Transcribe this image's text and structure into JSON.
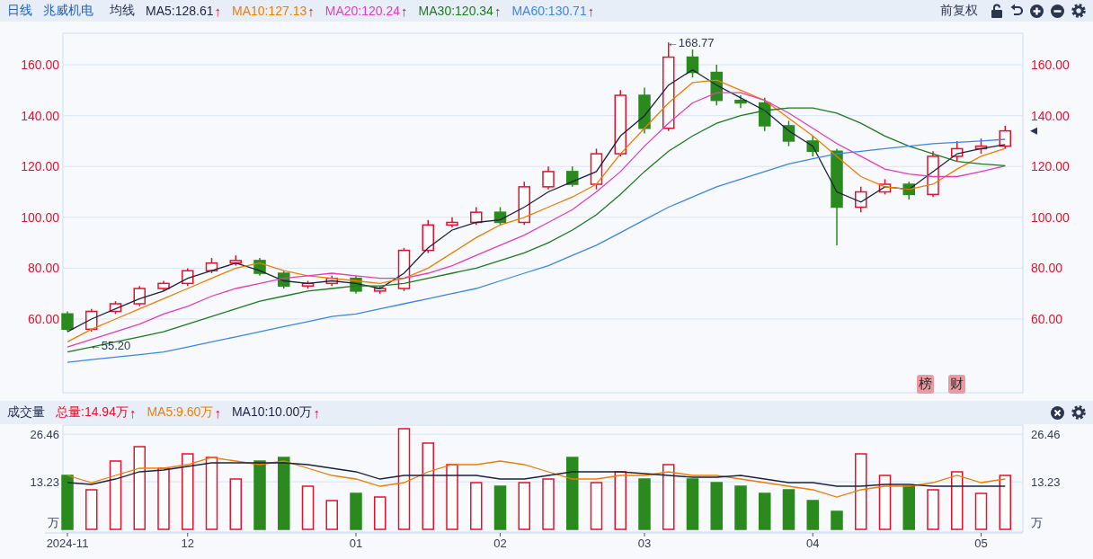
{
  "toolbar": {
    "period": "日线",
    "stock": "兆威机电",
    "indicator_title": "均线",
    "indicators": [
      {
        "label": "MA5:128.61",
        "color": "#1a2340",
        "arrow": "↑"
      },
      {
        "label": "MA10:127.13",
        "color": "#f07d00",
        "arrow": "↑"
      },
      {
        "label": "MA20:120.24",
        "color": "#e83cb4",
        "arrow": "↑"
      },
      {
        "label": "MA30:120.34",
        "color": "#1e7a1e",
        "arrow": "↑"
      },
      {
        "label": "MA60:130.71",
        "color": "#3a86e8",
        "arrow": "↑"
      }
    ],
    "adjust": "前复权"
  },
  "price_chart": {
    "markers": [
      {
        "label": "榜"
      },
      {
        "label": "财"
      }
    ],
    "chart_data": {
      "type": "candlestick",
      "ylim": [
        31,
        172.4
      ],
      "grid": true,
      "yticks": [
        {
          "value": 60,
          "label": "60.00"
        },
        {
          "value": 80,
          "label": "80.00"
        },
        {
          "value": 100,
          "label": "100.00"
        },
        {
          "value": 120,
          "label": "120.00"
        },
        {
          "value": 140,
          "label": "140.00"
        },
        {
          "value": 160,
          "label": "160.00"
        }
      ],
      "categories": [
        null,
        null,
        null,
        null,
        null,
        null,
        null,
        null,
        null,
        null,
        null,
        null,
        null,
        null,
        null,
        null,
        null,
        null,
        null,
        null,
        null,
        null,
        null,
        null,
        null,
        null,
        null,
        null,
        null,
        null,
        null,
        null,
        null,
        null,
        null,
        null,
        null,
        null,
        null,
        null
      ],
      "ohlc": [
        [
          62,
          63,
          55.2,
          56
        ],
        [
          56,
          64,
          55,
          63
        ],
        [
          63,
          67,
          62,
          66
        ],
        [
          66,
          73,
          65,
          72
        ],
        [
          72,
          75,
          71,
          74
        ],
        [
          74,
          80,
          73,
          79
        ],
        [
          79,
          84,
          78,
          82
        ],
        [
          82,
          85,
          81,
          83
        ],
        [
          83,
          84,
          77,
          78
        ],
        [
          78,
          79,
          72,
          73
        ],
        [
          73,
          75,
          72,
          74
        ],
        [
          74,
          77,
          73,
          76
        ],
        [
          76,
          77,
          70,
          71
        ],
        [
          71,
          73,
          70,
          72
        ],
        [
          72,
          88,
          71,
          87
        ],
        [
          87,
          99,
          86,
          97
        ],
        [
          97,
          100,
          96,
          98
        ],
        [
          98,
          104,
          97,
          102
        ],
        [
          102,
          104,
          97,
          98
        ],
        [
          98,
          114,
          97,
          112
        ],
        [
          112,
          120,
          111,
          118
        ],
        [
          118,
          120,
          112,
          113
        ],
        [
          113,
          127,
          111,
          125
        ],
        [
          125,
          150,
          124,
          148
        ],
        [
          148,
          151,
          133,
          135
        ],
        [
          135,
          168.77,
          134,
          163
        ],
        [
          163,
          166,
          155,
          157
        ],
        [
          157,
          160,
          144,
          146
        ],
        [
          146,
          148,
          143,
          145
        ],
        [
          145,
          147,
          134,
          136
        ],
        [
          136,
          138,
          128,
          130
        ],
        [
          130,
          132,
          124,
          126
        ],
        [
          126,
          127,
          89,
          104
        ],
        [
          104,
          112,
          102,
          110
        ],
        [
          110,
          115,
          109,
          113
        ],
        [
          113,
          114,
          107,
          109
        ],
        [
          109,
          126,
          108,
          124
        ],
        [
          124,
          130,
          122,
          127
        ],
        [
          127,
          131,
          125,
          128
        ],
        [
          128,
          136,
          127,
          134
        ]
      ],
      "series": [
        {
          "type": "line",
          "color": "#1a2340",
          "values": [
            55,
            60,
            64,
            68,
            71,
            76,
            79,
            82,
            79,
            75,
            74,
            75,
            74,
            72,
            78,
            88,
            95,
            98,
            99,
            104,
            110,
            114,
            118,
            132,
            140,
            152,
            158,
            152,
            147,
            142,
            134,
            128,
            110,
            106,
            112,
            111,
            118,
            125,
            127,
            128.6
          ]
        },
        {
          "type": "line",
          "color": "#f07d00",
          "values": [
            51,
            56,
            60,
            64,
            68,
            72,
            76,
            80,
            82,
            79,
            77,
            76,
            75,
            74,
            76,
            80,
            86,
            92,
            97,
            100,
            104,
            108,
            113,
            125,
            135,
            145,
            153,
            154,
            150,
            146,
            139,
            132,
            124,
            116,
            112,
            111,
            113,
            119,
            124,
            127.1
          ]
        },
        {
          "type": "line",
          "color": "#e83cb4",
          "values": [
            49,
            52,
            55,
            58,
            62,
            65,
            69,
            72,
            74,
            76,
            77,
            78,
            77,
            76,
            76,
            78,
            81,
            85,
            89,
            93,
            98,
            103,
            110,
            118,
            128,
            137,
            145,
            149,
            149,
            146,
            141,
            135,
            129,
            124,
            119,
            117,
            116,
            116,
            118,
            120.2
          ]
        },
        {
          "type": "line",
          "color": "#1e7a1e",
          "values": [
            47,
            49,
            51,
            53,
            55,
            58,
            61,
            64,
            67,
            69,
            71,
            72,
            73,
            73,
            74,
            76,
            78,
            80,
            83,
            86,
            90,
            95,
            101,
            109,
            118,
            126,
            132,
            137,
            140,
            142,
            143,
            143,
            141,
            137,
            132,
            128,
            125,
            122,
            121,
            120.3
          ]
        },
        {
          "type": "line",
          "color": "#3a86e8",
          "values": [
            43,
            44,
            45,
            46,
            47,
            49,
            51,
            53,
            55,
            57,
            59,
            61,
            62,
            64,
            66,
            68,
            70,
            72,
            75,
            78,
            81,
            85,
            89,
            94,
            99,
            104,
            108,
            112,
            115,
            118,
            121,
            123,
            125,
            126,
            127,
            128,
            129,
            129.5,
            130,
            130.7
          ]
        }
      ],
      "annotations": [
        "←168.77",
        "←55.20"
      ]
    }
  },
  "volume_header": {
    "title": "成交量",
    "indicators": [
      {
        "label": "总量:14.94万",
        "color": "#e8102a",
        "arrow": "↑"
      },
      {
        "label": "MA5:9.60万",
        "color": "#f07d00",
        "arrow": "↑"
      },
      {
        "label": "MA10:10.00万",
        "color": "#1a2340",
        "arrow": "↑"
      }
    ]
  },
  "volume_chart": {
    "chart_data": {
      "type": "bar",
      "ylim": [
        0,
        28.5
      ],
      "grid": true,
      "yticks": [
        {
          "value": 0,
          "label": "万"
        },
        {
          "value": 13.23,
          "label": "13.23"
        },
        {
          "value": 26.46,
          "label": "26.46"
        }
      ],
      "categories": [
        "2024-11",
        null,
        null,
        null,
        null,
        "12",
        null,
        null,
        null,
        null,
        null,
        null,
        "01",
        null,
        null,
        null,
        null,
        null,
        "02",
        null,
        null,
        null,
        null,
        null,
        "03",
        null,
        null,
        null,
        null,
        null,
        null,
        "04",
        null,
        null,
        null,
        null,
        null,
        null,
        "05",
        null
      ],
      "series": [
        {
          "type": "bar",
          "color": "#e8102a",
          "values": [
            null,
            11,
            19,
            23,
            17,
            21,
            20,
            14,
            null,
            null,
            12,
            8,
            null,
            9,
            28,
            24,
            18,
            13,
            null,
            13,
            14,
            null,
            13,
            16,
            null,
            18,
            null,
            null,
            null,
            null,
            null,
            null,
            null,
            21,
            15,
            null,
            11,
            16,
            10,
            15
          ]
        },
        {
          "type": "bar",
          "color": "#2a8a1e",
          "values": [
            15,
            null,
            null,
            null,
            null,
            null,
            null,
            null,
            19,
            20,
            null,
            null,
            10,
            null,
            null,
            null,
            null,
            null,
            12,
            null,
            null,
            20,
            null,
            null,
            14,
            null,
            14,
            13,
            12,
            10,
            11,
            8,
            5,
            null,
            null,
            12,
            null,
            null,
            null,
            null
          ]
        },
        {
          "type": "line",
          "color": "#f07d00",
          "values": [
            15,
            13,
            15,
            17,
            17,
            18,
            20,
            19,
            18,
            19,
            17,
            15,
            14,
            12,
            13,
            16,
            18,
            18,
            19,
            18,
            16,
            14,
            14,
            15,
            15,
            16,
            15,
            15,
            14,
            13,
            12,
            11,
            9,
            11,
            12,
            12,
            13,
            15,
            13,
            14
          ]
        },
        {
          "type": "line",
          "color": "#1a2340",
          "values": [
            13,
            12.5,
            14,
            16,
            16.5,
            17.5,
            18.5,
            18.5,
            18.5,
            18.5,
            18,
            17,
            16,
            14,
            15,
            15,
            15,
            15,
            14,
            14,
            15,
            16,
            16,
            16,
            15.5,
            15,
            14.5,
            14.5,
            15,
            14,
            13,
            13,
            12,
            12,
            12.5,
            12.5,
            12,
            12,
            12,
            12
          ]
        }
      ]
    }
  }
}
